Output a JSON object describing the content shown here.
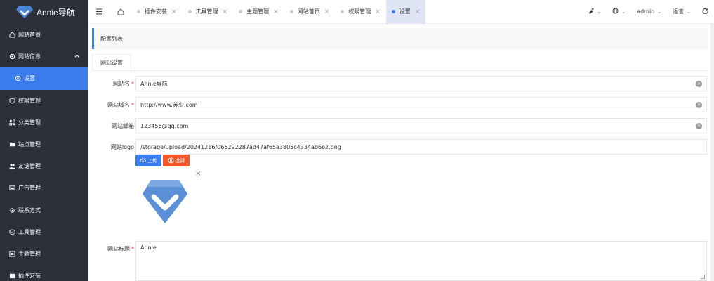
{
  "brand": {
    "name": "Annie导航",
    "logo_color": "#4a86d8"
  },
  "sidebar": {
    "items": [
      {
        "label": "网站首页",
        "icon": "home-icon"
      },
      {
        "label": "网站信息",
        "icon": "gear-icon",
        "expanded": true
      },
      {
        "label": "设置",
        "icon": "gear-icon",
        "active": true
      },
      {
        "label": "权限管理",
        "icon": "shield-icon"
      },
      {
        "label": "分类管理",
        "icon": "category-icon"
      },
      {
        "label": "站点管理",
        "icon": "folder-icon"
      },
      {
        "label": "友链管理",
        "icon": "users-icon"
      },
      {
        "label": "广告管理",
        "icon": "image-icon"
      },
      {
        "label": "联系方式",
        "icon": "contact-icon"
      },
      {
        "label": "工具管理",
        "icon": "tool-icon"
      },
      {
        "label": "主题管理",
        "icon": "theme-icon"
      },
      {
        "label": "插件安装",
        "icon": "plugin-icon"
      }
    ]
  },
  "topbar": {
    "tabs": [
      {
        "label": "插件安装"
      },
      {
        "label": "工具管理"
      },
      {
        "label": "主题管理"
      },
      {
        "label": "网站首页"
      },
      {
        "label": "权限管理"
      },
      {
        "label": "设置",
        "active": true
      }
    ],
    "user": "admin",
    "language": "语言"
  },
  "panel": {
    "title": "配置列表",
    "tab": "网站设置"
  },
  "form": {
    "site_name": {
      "label": "网站名",
      "value": "Annie导航",
      "required": true
    },
    "site_domain": {
      "label": "网站域名",
      "value": "http://www.苏少.com",
      "required": true
    },
    "site_email": {
      "label": "网站邮箱",
      "value": "123456@qq.com",
      "required": false
    },
    "site_logo": {
      "label": "网站logo",
      "value": "/storage/upload/20241216/065292287ad47af65a3805c4334ab6e2.png"
    },
    "upload_button": "上传",
    "select_button": "选择",
    "site_title": {
      "label": "网站标题",
      "value": "Annie",
      "required": true
    }
  },
  "colors": {
    "accent": "#3a7cec",
    "sidebar_bg": "#2b303b",
    "danger": "#f0572b"
  }
}
